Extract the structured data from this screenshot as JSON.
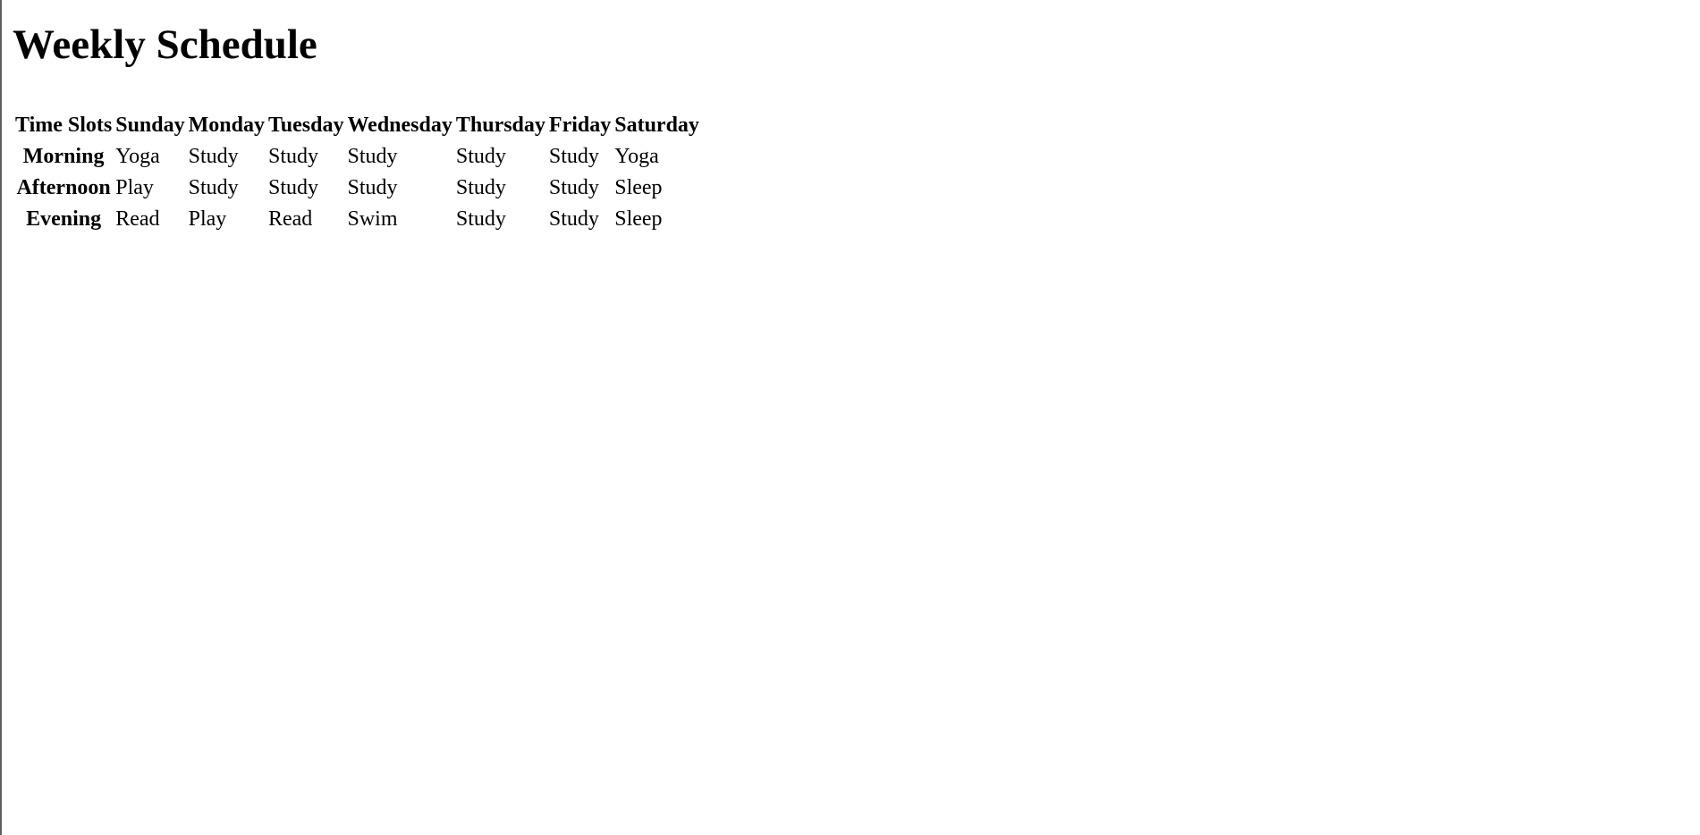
{
  "title": "Weekly Schedule",
  "table": {
    "headers": [
      "Time Slots",
      "Sunday",
      "Monday",
      "Tuesday",
      "Wednesday",
      "Thursday",
      "Friday",
      "Saturday"
    ],
    "rows": [
      {
        "slot": "Morning",
        "cells": [
          "Yoga",
          "Study",
          "Study",
          "Study",
          "Study",
          "Study",
          "Yoga"
        ]
      },
      {
        "slot": "Afternoon",
        "cells": [
          "Play",
          "Study",
          "Study",
          "Study",
          "Study",
          "Study",
          "Sleep"
        ]
      },
      {
        "slot": "Evening",
        "cells": [
          "Read",
          "Play",
          "Read",
          "Swim",
          "Study",
          "Study",
          "Sleep"
        ]
      }
    ]
  }
}
